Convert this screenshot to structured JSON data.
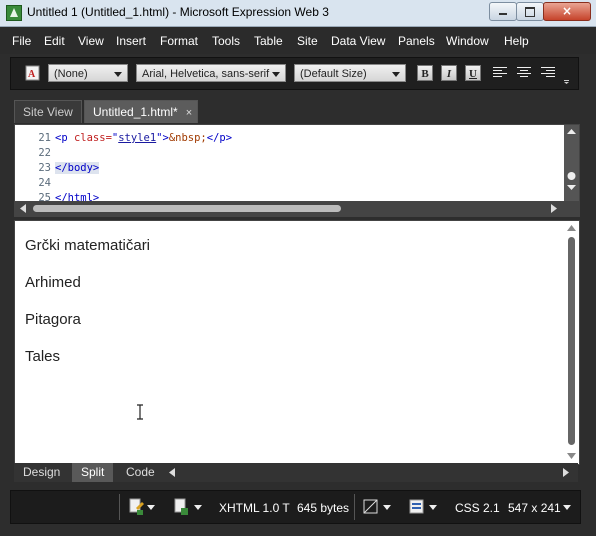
{
  "window": {
    "title": "Untitled 1 (Untitled_1.html) - Microsoft Expression Web 3",
    "icon": "expression-web-icon",
    "controls": {
      "minimize": "minimize-icon",
      "maximize": "maximize-icon",
      "close": "×"
    }
  },
  "menu": [
    "File",
    "Edit",
    "View",
    "Insert",
    "Format",
    "Tools",
    "Table",
    "Site",
    "Data View",
    "Panels",
    "Window",
    "Help"
  ],
  "toolbar": {
    "style": "(None)",
    "font": "Arial, Helvetica, sans-serif",
    "size": "(Default Size)",
    "bold": "B",
    "italic": "I",
    "underline": "U"
  },
  "tabs": [
    {
      "label": "Site View"
    },
    {
      "label": "Untitled_1.html*",
      "close": "×"
    }
  ],
  "code": [
    {
      "num": "21",
      "open": "<p ",
      "attr": "class=",
      "q1": "\"",
      "val": "style1",
      "q2": "\"",
      "close": ">",
      "entity": "&nbsp;",
      "end": "</p>"
    },
    {
      "num": "22"
    },
    {
      "num": "23",
      "text": "</body>"
    },
    {
      "num": "24"
    },
    {
      "num": "25",
      "text": "</html>"
    }
  ],
  "design": [
    "Grčki matematičari",
    "Arhimed",
    "Pitagora",
    "Tales"
  ],
  "views": [
    "Design",
    "Split",
    "Code"
  ],
  "status": {
    "doctype": "XHTML 1.0 T",
    "size": "645 bytes",
    "css": "CSS 2.1",
    "dimensions": "547 x 241"
  },
  "colors": {
    "accent": "#595959",
    "tag": "#0000c8",
    "attr": "#c02020"
  }
}
